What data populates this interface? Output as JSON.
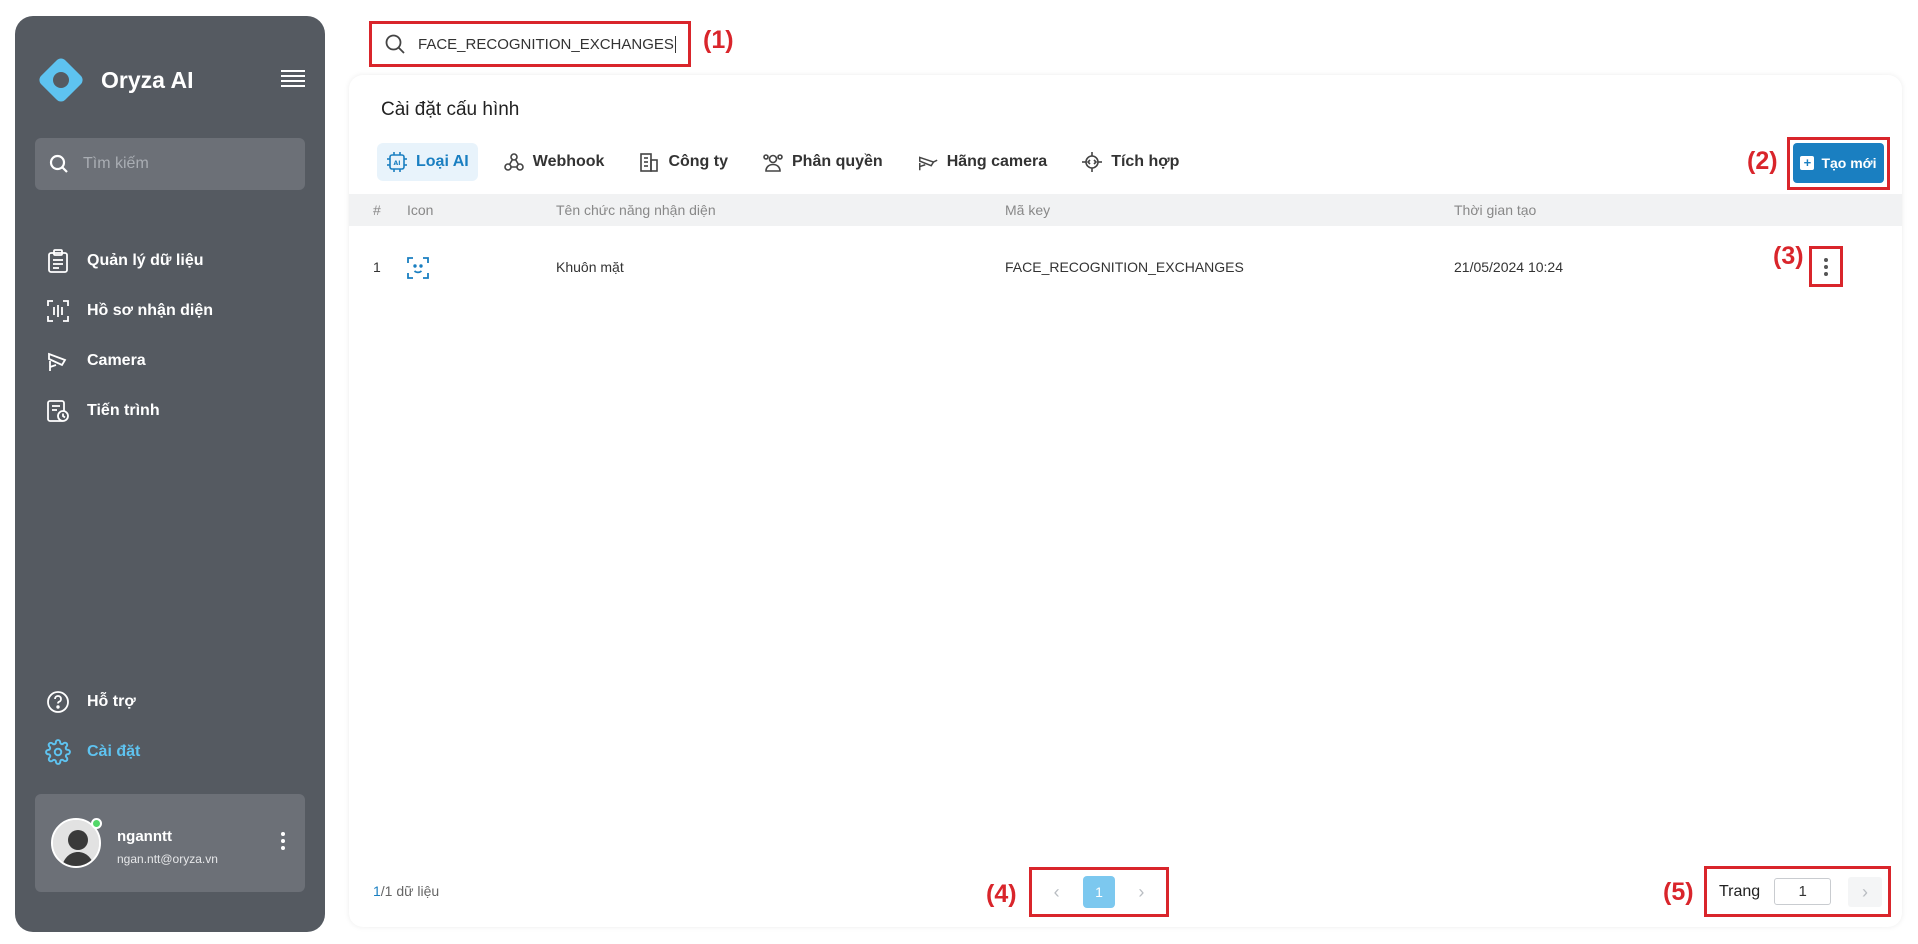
{
  "sidebar": {
    "brand_name": "Oryza AI",
    "search_placeholder": "Tìm kiếm",
    "nav_items": [
      {
        "label": "Quản lý dữ liệu",
        "icon": "clipboard-list-icon"
      },
      {
        "label": "Hồ sơ nhận diện",
        "icon": "face-scan-icon"
      },
      {
        "label": "Camera",
        "icon": "cctv-icon"
      },
      {
        "label": "Tiến trình",
        "icon": "schedule-doc-icon"
      }
    ],
    "bottom_items": [
      {
        "label": "Hỗ trợ",
        "icon": "help-circle-icon"
      },
      {
        "label": "Cài đặt",
        "icon": "gear-icon",
        "active": true
      }
    ],
    "user": {
      "name": "nganntt",
      "email": "ngan.ntt@oryza.vn"
    }
  },
  "top_search": {
    "value": "FACE_RECOGNITION_EXCHANGES"
  },
  "annotations": {
    "a1": "(1)",
    "a2": "(2)",
    "a3": "(3)",
    "a4": "(4)",
    "a5": "(5)"
  },
  "page": {
    "title": "Cài đặt cấu hình",
    "tabs": [
      {
        "label": "Loại AI",
        "icon": "ai-chip-icon",
        "active": true
      },
      {
        "label": "Webhook",
        "icon": "webhook-icon"
      },
      {
        "label": "Công ty",
        "icon": "building-icon"
      },
      {
        "label": "Phân quyền",
        "icon": "users-group-icon"
      },
      {
        "label": "Hãng camera",
        "icon": "camera-icon"
      },
      {
        "label": "Tích hợp",
        "icon": "integration-chip-icon"
      }
    ],
    "create_button": "Tạo mới"
  },
  "table": {
    "headers": [
      "#",
      "Icon",
      "Tên chức năng nhận diện",
      "Mã key",
      "Thời gian tạo"
    ],
    "rows": [
      {
        "index": "1",
        "icon": "face-recognition-icon",
        "name": "Khuôn mặt",
        "key": "FACE_RECOGNITION_EXCHANGES",
        "created": "21/05/2024 10:24"
      }
    ]
  },
  "footer": {
    "summary_count": "1",
    "summary_total": "/1",
    "summary_suffix": " dữ liệu",
    "current_page": "1",
    "page_label": "Trang",
    "page_input": "1"
  },
  "colors": {
    "sidebar_bg": "#555a61",
    "accent": "#1a7fc1",
    "active_nav": "#5ec3f0",
    "annotation": "#d9252b"
  }
}
